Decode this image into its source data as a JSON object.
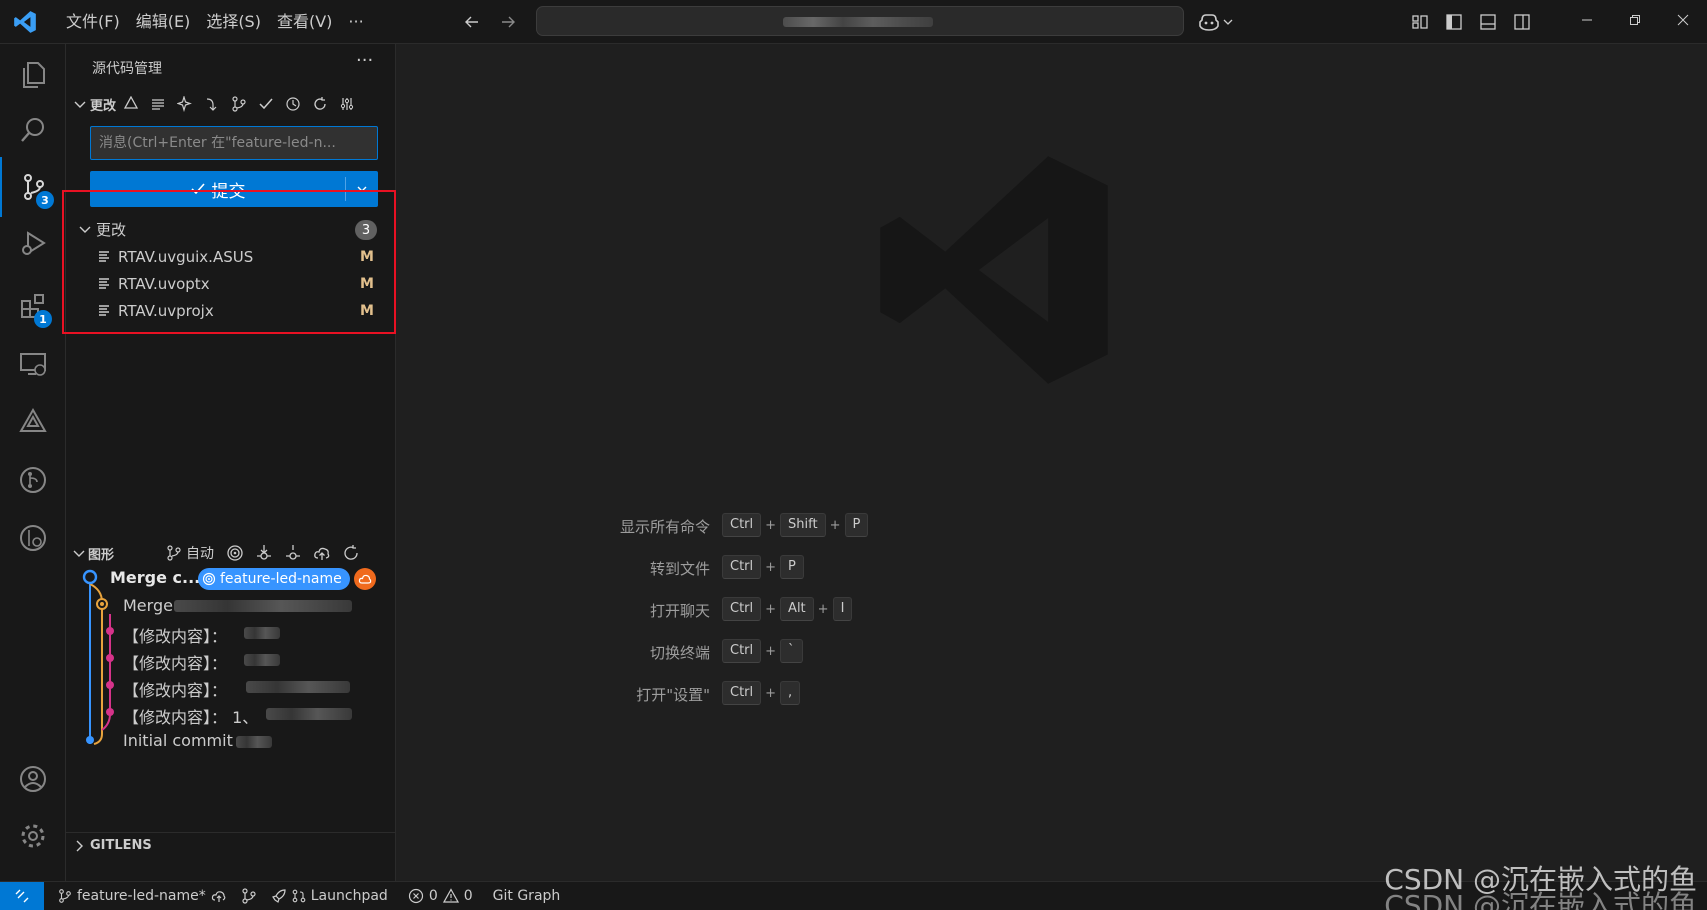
{
  "menu": [
    "文件(F)",
    "编辑(E)",
    "选择(S)",
    "查看(V)",
    "···"
  ],
  "activity": {
    "scm_badge": "3",
    "extensions_badge": "1"
  },
  "sidebar": {
    "title": "源代码管理",
    "more": "···",
    "scm_label": "更改",
    "message_placeholder": "消息(Ctrl+Enter 在\"feature-led-n...",
    "commit_label": "提交",
    "changes_label": "更改",
    "changes_count": "3",
    "files": [
      {
        "name": "RTAV.uvguix.ASUS",
        "status": "M"
      },
      {
        "name": "RTAV.uvoptx",
        "status": "M"
      },
      {
        "name": "RTAV.uvprojx",
        "status": "M"
      }
    ],
    "graph": {
      "label": "图形",
      "auto": "自动",
      "branch_tag": "feature-led-name",
      "commits": [
        "Merge c...",
        "Merge",
        "【修改内容】：",
        "【修改内容】：",
        "【修改内容】：",
        "【修改内容】： 1、",
        "Initial commit"
      ]
    },
    "gitlens_label": "GITLENS"
  },
  "editor": {
    "shortcuts": [
      {
        "label": "显示所有命令",
        "keys": [
          "Ctrl",
          "Shift",
          "P"
        ]
      },
      {
        "label": "转到文件",
        "keys": [
          "Ctrl",
          "P"
        ]
      },
      {
        "label": "打开聊天",
        "keys": [
          "Ctrl",
          "Alt",
          "I"
        ]
      },
      {
        "label": "切换终端",
        "keys": [
          "Ctrl",
          "`"
        ]
      },
      {
        "label": "打开\"设置\"",
        "keys": [
          "Ctrl",
          ","
        ]
      }
    ]
  },
  "status": {
    "branch": "feature-led-name*",
    "launchpad": "Launchpad",
    "errors": "0",
    "warnings": "0",
    "git_graph": "Git Graph"
  },
  "watermark": "CSDN @沉在嵌入式的鱼",
  "colors": {
    "accent": "#0078d4",
    "modified": "#e2c08d",
    "highlight_box": "#e81123",
    "branch_tag": "#3794ff",
    "cloud": "#f06a1d"
  }
}
